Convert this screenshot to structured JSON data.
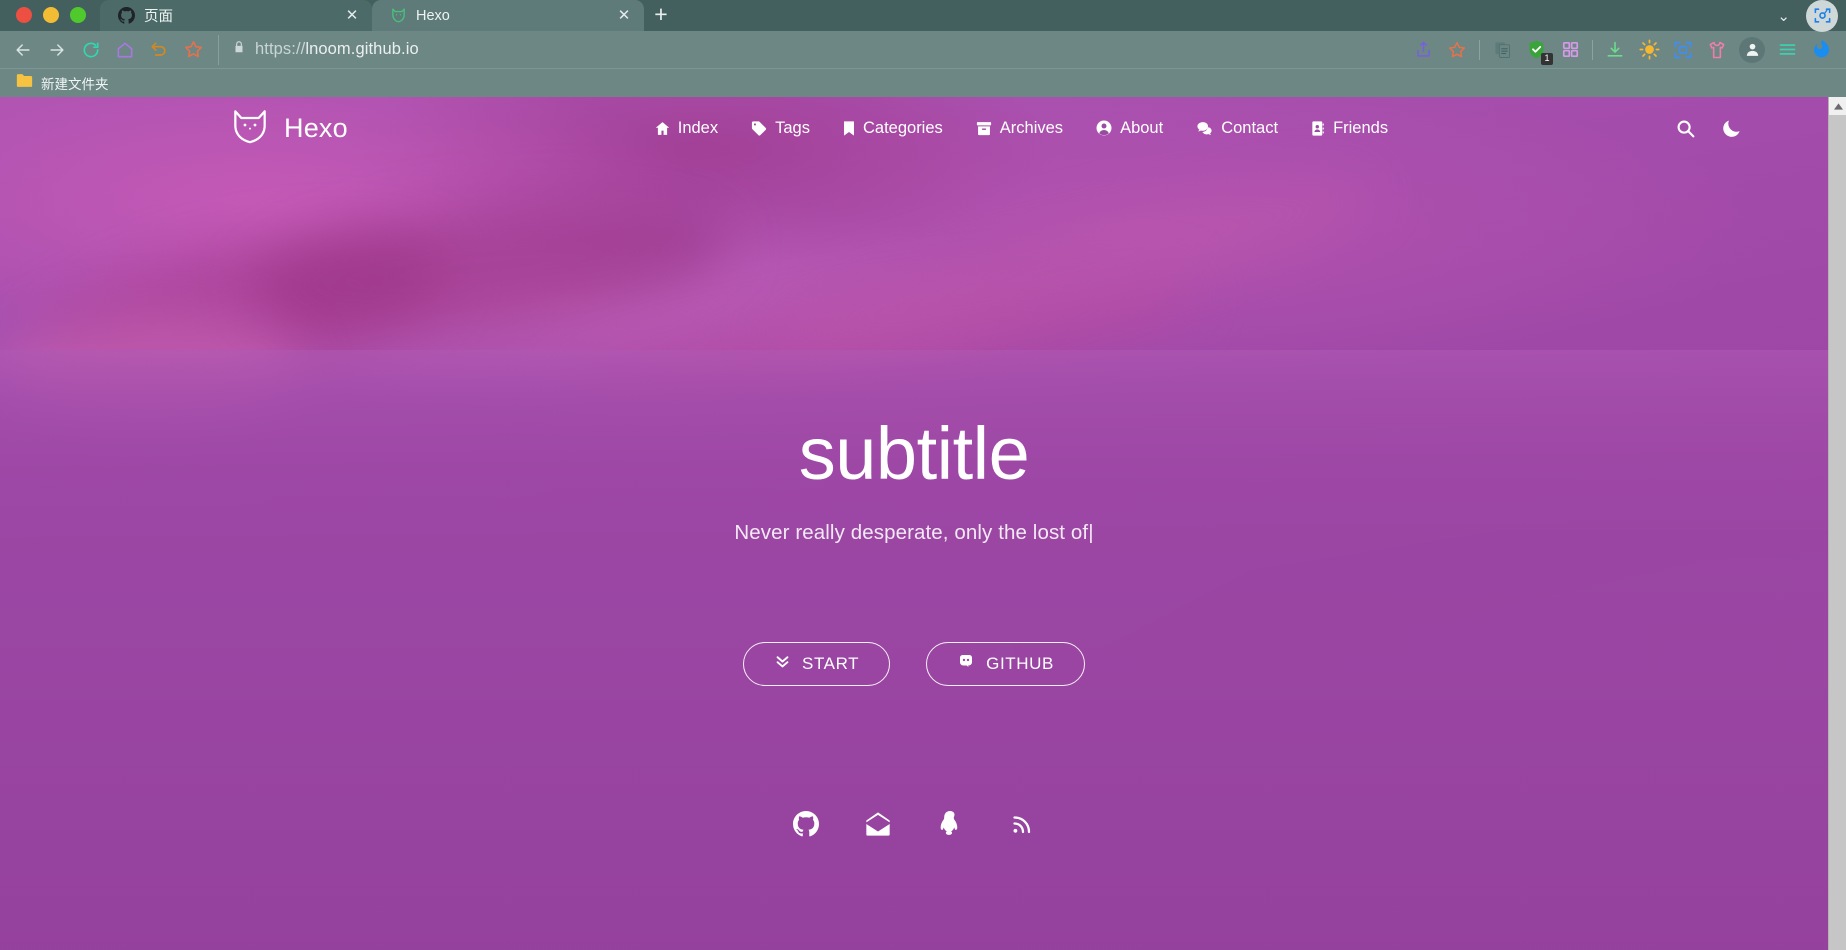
{
  "browser": {
    "window_controls": [
      "close",
      "minimize",
      "maximize"
    ],
    "tabs": [
      {
        "title": "页面",
        "favicon": "github-icon",
        "active": false,
        "close_label": "✕"
      },
      {
        "title": "Hexo",
        "favicon": "hexo-fox-icon",
        "active": true,
        "close_label": "✕"
      }
    ],
    "new_tab_label": "+",
    "tabstrip_right": {
      "chevron_label": "⌄",
      "capture_icon": "screenshot-capture-icon"
    },
    "nav_buttons": [
      {
        "name": "back-button",
        "icon": "arrow-left-icon",
        "color": "#d6e0df"
      },
      {
        "name": "forward-button",
        "icon": "arrow-right-icon",
        "color": "#d6e0df"
      },
      {
        "name": "reload-button",
        "icon": "reload-icon",
        "color": "#2fd9b0"
      },
      {
        "name": "home-button",
        "icon": "home-icon",
        "color": "#a779e0"
      },
      {
        "name": "history-button",
        "icon": "undo-arrow-icon",
        "color": "#d08a1f"
      },
      {
        "name": "bookmark-star-button",
        "icon": "star-icon",
        "color": "#e8714a"
      }
    ],
    "address": {
      "lock_icon": "padlock-icon",
      "scheme": "https://",
      "host": "lnoom.github.io",
      "full_url": "https://lnoom.github.io"
    },
    "toolbar_right": [
      {
        "name": "share-button",
        "icon": "share-upload-icon",
        "color": "#7a5de0"
      },
      {
        "name": "favorite-button",
        "icon": "star-icon",
        "color": "#e8714a"
      },
      {
        "name": "clipboard-button",
        "icon": "clipboard-copy-icon",
        "color": "#5f7b79"
      },
      {
        "name": "adblock-button",
        "icon": "shield-check-icon",
        "color": "#3aa33a",
        "badge": "1"
      },
      {
        "name": "extensions-grid-button",
        "icon": "grid-squares-icon",
        "color": "#d79ae8"
      },
      {
        "name": "downloads-button",
        "icon": "download-icon",
        "color": "#6ddc8e"
      },
      {
        "name": "brightness-button",
        "icon": "sun-icon",
        "color": "#f7b731"
      },
      {
        "name": "screenshot-button",
        "icon": "screen-capture-icon",
        "color": "#3d8ef7"
      },
      {
        "name": "theme-button",
        "icon": "tshirt-icon",
        "color": "#f07ea8"
      },
      {
        "name": "profile-button",
        "icon": "user-avatar-icon",
        "color": "#e6eceb"
      },
      {
        "name": "menu-button",
        "icon": "hamburger-menu-icon",
        "color": "#3ecfae"
      },
      {
        "name": "browser-logo",
        "icon": "browser-logo-icon",
        "color": "#1a8df0"
      }
    ],
    "bookmarks": [
      {
        "label": "新建文件夹",
        "icon": "folder-icon",
        "color": "#f5c242"
      }
    ]
  },
  "site": {
    "brand": {
      "name": "Hexo",
      "logo_icon": "fox-head-icon"
    },
    "nav": [
      {
        "label": "Index",
        "icon": "home-icon"
      },
      {
        "label": "Tags",
        "icon": "tag-icon"
      },
      {
        "label": "Categories",
        "icon": "bookmark-icon"
      },
      {
        "label": "Archives",
        "icon": "archive-box-icon"
      },
      {
        "label": "About",
        "icon": "user-circle-icon"
      },
      {
        "label": "Contact",
        "icon": "comments-icon"
      },
      {
        "label": "Friends",
        "icon": "address-book-icon"
      }
    ],
    "nav_tools": [
      {
        "name": "search-button",
        "icon": "search-icon"
      },
      {
        "name": "dark-mode-toggle",
        "icon": "moon-icon"
      }
    ],
    "hero": {
      "title": "subtitle",
      "tagline": "Never really desperate, only the lost of",
      "typing_cursor": "|",
      "buttons": [
        {
          "label": "START",
          "icon": "chevron-double-down-icon"
        },
        {
          "label": "GITHUB",
          "icon": "github-icon"
        }
      ],
      "socials": [
        {
          "name": "github-link",
          "icon": "github-icon"
        },
        {
          "name": "email-link",
          "icon": "envelope-open-icon"
        },
        {
          "name": "qq-link",
          "icon": "qq-penguin-icon"
        },
        {
          "name": "rss-link",
          "icon": "rss-icon"
        }
      ]
    }
  },
  "colors": {
    "chrome_tabstrip": "#44605e",
    "chrome_toolbar": "#6d8785",
    "tab_active": "#5e7b79",
    "hero_purple": "#9b4aa3",
    "hero_text": "#ffffff",
    "scrollbar_track": "#c6c6c6"
  },
  "scrollbar": {
    "up_arrow": "▲",
    "down_arrow": "▼"
  }
}
